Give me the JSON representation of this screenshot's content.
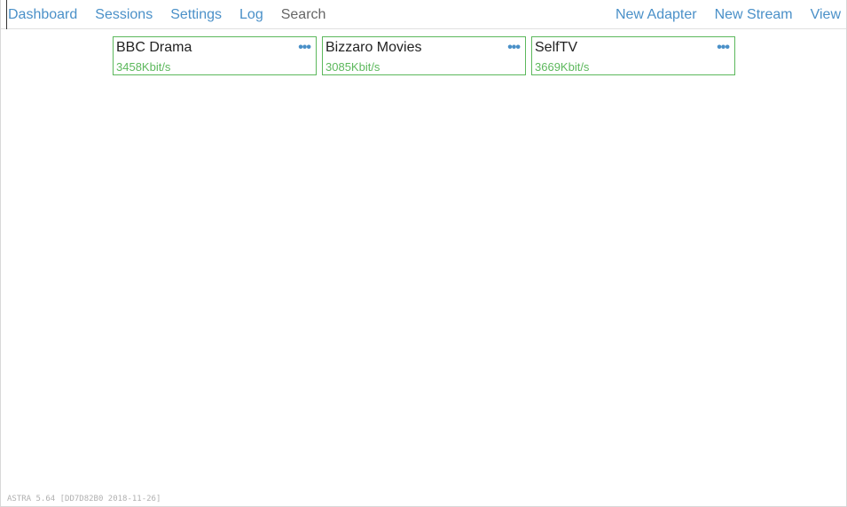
{
  "nav": {
    "left": [
      {
        "label": "Dashboard"
      },
      {
        "label": "Sessions"
      },
      {
        "label": "Settings"
      },
      {
        "label": "Log"
      },
      {
        "label": "Search"
      }
    ],
    "right": [
      {
        "label": "New Adapter"
      },
      {
        "label": "New Stream"
      },
      {
        "label": "View"
      }
    ]
  },
  "streams": [
    {
      "name": "BBC Drama",
      "bitrate": "3458Kbit/s",
      "menu_icon": "ellipsis-icon"
    },
    {
      "name": "Bizzaro Movies",
      "bitrate": "3085Kbit/s",
      "menu_icon": "ellipsis-icon"
    },
    {
      "name": "SelfTV",
      "bitrate": "3669Kbit/s",
      "menu_icon": "ellipsis-icon"
    }
  ],
  "footer": {
    "version": "ASTRA 5.64 [DD7D82B0 2018-11-26]"
  },
  "colors": {
    "link": "#4a90c8",
    "online": "#5cb85c",
    "muted": "#b0b0b0"
  }
}
